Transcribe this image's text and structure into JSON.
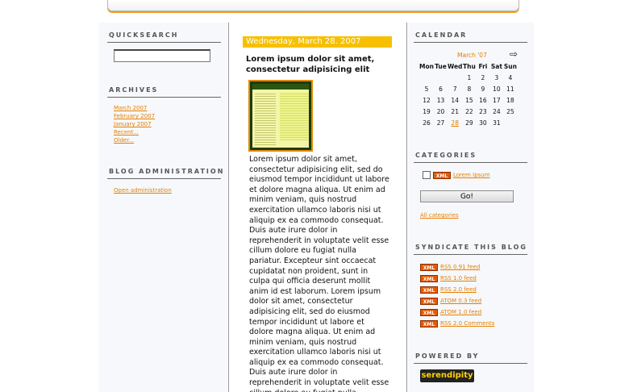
{
  "sidebar_left": {
    "quicksearch_title": "QUICKSEARCH",
    "archives_title": "ARCHIVES",
    "archives": [
      "March 2007",
      "February 2007",
      "January 2007",
      "Recent...",
      "Older..."
    ],
    "admin_title": "BLOG ADMINISTRATION",
    "admin_link": "Open administration"
  },
  "post": {
    "date": "Wednesday, March 28. 2007",
    "title": "Lorem ipsum dolor sit amet, consectetur adipisicing elit",
    "body": "Lorem ipsum dolor sit amet, consectetur adipisicing elit, sed do eiusmod tempor incididunt ut labore et dolore magna aliqua. Ut enim ad minim veniam, quis nostrud exercitation ullamco laboris nisi ut aliquip ex ea commodo consequat. Duis aute irure dolor in reprehenderit in voluptate velit esse cillum dolore eu fugiat nulla pariatur. Excepteur sint occaecat cupidatat non proident, sunt in culpa qui officia deserunt mollit anim id est laborum. Lorem ipsum dolor sit amet, consectetur adipisicing elit, sed do eiusmod tempor incididunt ut labore et dolore magna aliqua. Ut enim ad minim veniam, quis nostrud exercitation ullamco laboris nisi ut aliquip ex ea commodo consequat. Duis aute irure dolor in reprehenderit in voluptate velit esse cillum dolore eu fugiat nulla pariatur. Excepteur sint occaecat"
  },
  "calendar": {
    "title": "CALENDAR",
    "month": "March '07",
    "next_icon": "arrow-right-icon",
    "weekdays": [
      "Mon",
      "Tue",
      "Wed",
      "Thu",
      "Fri",
      "Sat",
      "Sun"
    ],
    "weeks": [
      [
        "",
        "",
        "",
        "1",
        "2",
        "3",
        "4"
      ],
      [
        "5",
        "6",
        "7",
        "8",
        "9",
        "10",
        "11"
      ],
      [
        "12",
        "13",
        "14",
        "15",
        "16",
        "17",
        "18"
      ],
      [
        "19",
        "20",
        "21",
        "22",
        "23",
        "24",
        "25"
      ],
      [
        "26",
        "27",
        "28",
        "29",
        "30",
        "31",
        ""
      ]
    ],
    "highlight_day": "28",
    "highlight_color": "#e67e00"
  },
  "categories": {
    "title": "CATEGORIES",
    "badge": "XML",
    "item": "Lorem Ipsum",
    "go_label": "Go!",
    "all_link": "All categories"
  },
  "syndicate": {
    "title": "SYNDICATE THIS BLOG",
    "badge": "XML",
    "feeds": [
      "RSS 0.91 feed",
      "RSS 1.0 feed",
      "RSS 2.0 feed",
      "ATOM 0.3 feed",
      "ATOM 1.0 feed",
      "RSS 2.0 Comments"
    ]
  },
  "powered": {
    "title": "POWERED BY",
    "logo_text": "serendipity"
  },
  "colors": {
    "accent": "#e67e00",
    "date_bar": "#f6c000",
    "xml_badge": "#e65a00"
  }
}
